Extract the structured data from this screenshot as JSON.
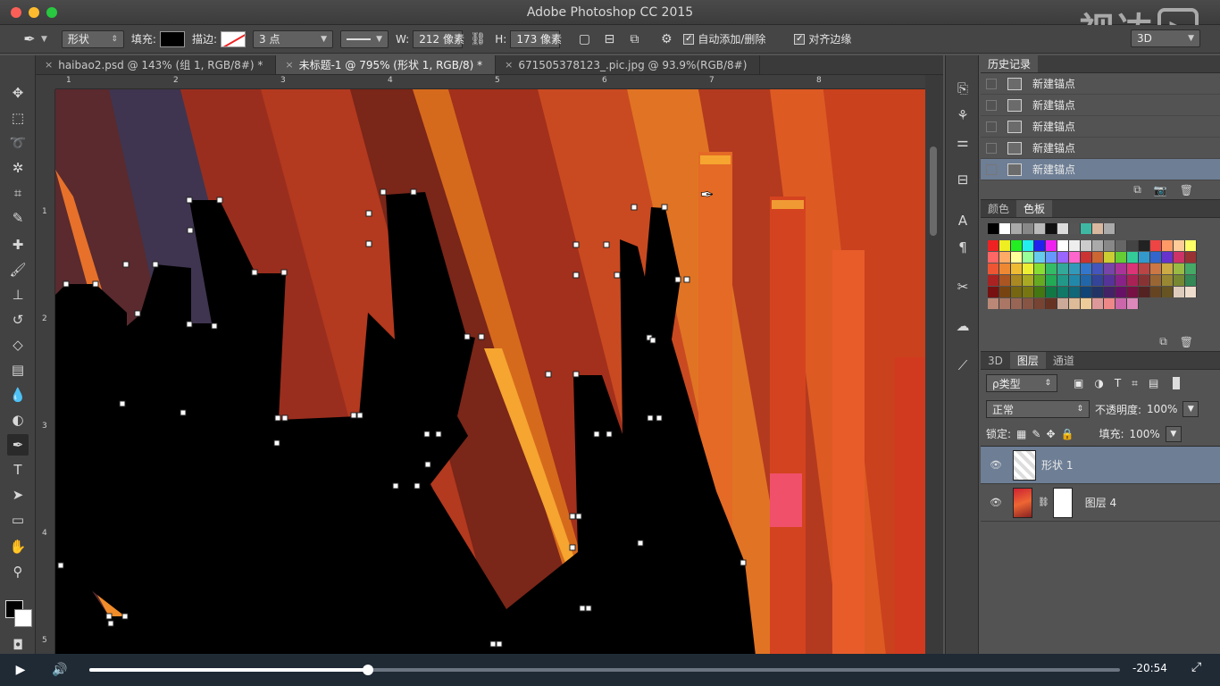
{
  "app": {
    "title": "Adobe Photoshop CC 2015",
    "watermark": "视达",
    "watermark_icon": "play-icon"
  },
  "options": {
    "shape_mode": "形状",
    "fill_label": "填充:",
    "stroke_label": "描边:",
    "stroke_size": "3 点",
    "w_label": "W:",
    "w_value": "212 像素",
    "h_label": "H:",
    "h_value": "173 像素",
    "auto_add_label": "自动添加/删除",
    "align_edges_label": "对齐边缘",
    "view_3d": "3D"
  },
  "tabs": [
    {
      "label": "haibao2.psd @ 143% (组 1, RGB/8#) *"
    },
    {
      "label": "未标题-1 @ 795% (形状 1, RGB/8) *"
    },
    {
      "label": "671505378123_.pic.jpg @ 93.9%(RGB/8#)"
    }
  ],
  "rulers": {
    "top": [
      "1",
      "2",
      "3",
      "4",
      "5",
      "6",
      "7",
      "8"
    ],
    "left": [
      "1",
      "2",
      "3",
      "4",
      "5"
    ]
  },
  "history": {
    "tab": "历史记录",
    "items": [
      "新建锚点",
      "新建锚点",
      "新建锚点",
      "新建锚点",
      "新建锚点"
    ]
  },
  "swatches": {
    "tab_color": "颜色",
    "tab_swatches": "色板"
  },
  "layers": {
    "tab_3d": "3D",
    "tab_layers": "图层",
    "tab_channels": "通道",
    "filter_kind": "ρ类型",
    "blend_mode": "正常",
    "opacity_label": "不透明度:",
    "opacity_value": "100%",
    "lock_label": "锁定:",
    "fill_label": "填充:",
    "fill_value": "100%",
    "items": [
      {
        "name": "形状 1"
      },
      {
        "name": "图层 4"
      }
    ]
  },
  "video": {
    "time_remaining": "-20:54",
    "progress": 0.27
  }
}
